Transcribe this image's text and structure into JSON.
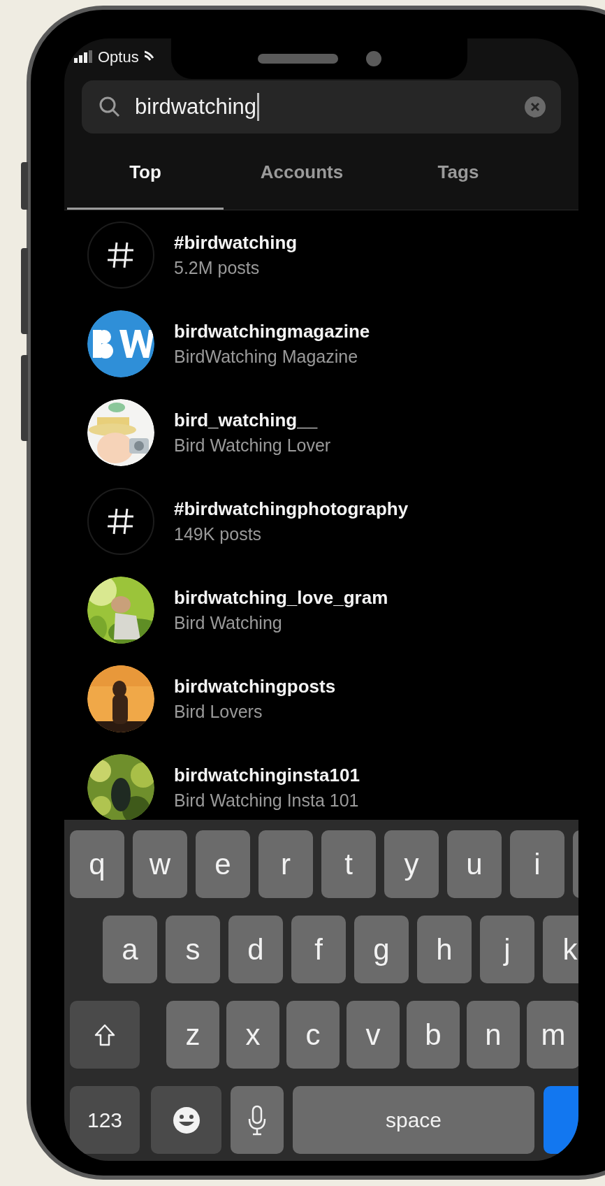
{
  "status_bar": {
    "carrier": "Optus"
  },
  "search": {
    "value": "birdwatching"
  },
  "tabs": [
    {
      "label": "Top",
      "selected": true
    },
    {
      "label": "Accounts",
      "selected": false
    },
    {
      "label": "Tags",
      "selected": false
    }
  ],
  "results": [
    {
      "kind": "hashtag",
      "title": "#birdwatching",
      "subtitle": "5.2M posts"
    },
    {
      "kind": "account",
      "title": "birdwatchingmagazine",
      "subtitle": "BirdWatching Magazine"
    },
    {
      "kind": "account",
      "title": "bird_watching__",
      "subtitle": "Bird Watching Lover"
    },
    {
      "kind": "hashtag",
      "title": "#birdwatchingphotography",
      "subtitle": "149K posts"
    },
    {
      "kind": "account",
      "title": "birdwatching_love_gram",
      "subtitle": "Bird Watching"
    },
    {
      "kind": "account",
      "title": "birdwatchingposts",
      "subtitle": "Bird Lovers"
    },
    {
      "kind": "account",
      "title": "birdwatchinginsta101",
      "subtitle": "Bird Watching Insta 101"
    }
  ],
  "keyboard": {
    "rows": [
      {
        "keys": [
          {
            "kind": "letter",
            "label": "q"
          },
          {
            "kind": "letter",
            "label": "w"
          },
          {
            "kind": "letter",
            "label": "e"
          },
          {
            "kind": "letter",
            "label": "r"
          },
          {
            "kind": "letter",
            "label": "t"
          },
          {
            "kind": "letter",
            "label": "y"
          },
          {
            "kind": "letter",
            "label": "u"
          },
          {
            "kind": "letter",
            "label": "i"
          },
          {
            "kind": "blank"
          }
        ]
      },
      {
        "keys": [
          {
            "kind": "letter",
            "label": "a"
          },
          {
            "kind": "letter",
            "label": "s"
          },
          {
            "kind": "letter",
            "label": "d"
          },
          {
            "kind": "letter",
            "label": "f"
          },
          {
            "kind": "letter",
            "label": "g"
          },
          {
            "kind": "letter",
            "label": "h"
          },
          {
            "kind": "letter",
            "label": "j"
          },
          {
            "kind": "letter",
            "label": "k"
          }
        ]
      },
      {
        "keys": [
          {
            "kind": "shift"
          },
          {
            "kind": "letter",
            "label": "z"
          },
          {
            "kind": "letter",
            "label": "x"
          },
          {
            "kind": "letter",
            "label": "c"
          },
          {
            "kind": "letter",
            "label": "v"
          },
          {
            "kind": "letter",
            "label": "b"
          },
          {
            "kind": "letter",
            "label": "n"
          },
          {
            "kind": "letter",
            "label": "m"
          }
        ]
      },
      {
        "keys": [
          {
            "kind": "mode",
            "label": "123"
          },
          {
            "kind": "emoji"
          },
          {
            "kind": "mic"
          },
          {
            "kind": "space",
            "label": "space"
          },
          {
            "kind": "return"
          }
        ]
      }
    ]
  }
}
